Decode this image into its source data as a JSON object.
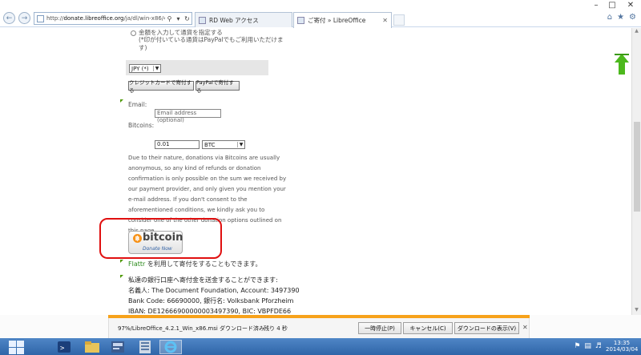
{
  "browser": {
    "url_prefix": "http://",
    "url_host": "donate.libreoffice.org",
    "url_path": "/ja/dl/win-x86/4.2.1/ja/Li",
    "tabs": [
      {
        "label": "RD Web アクセス"
      },
      {
        "label": "ご寄付 » LibreOffice"
      }
    ]
  },
  "page": {
    "amount_label": "金額を入力して通貨を指定する",
    "amount_note": "(*印が付いている通貨はPayPalでもご利用いただけます)",
    "currency_value": "JPY (*)",
    "card_button": "クレジットカードで寄付する",
    "paypal_button": "PayPalで寄付する",
    "email_label": "Email:",
    "email_placeholder": "Email address (optional)",
    "bitcoins_label": "Bitcoins:",
    "btc_amount": "0.01",
    "btc_currency": "BTC",
    "disclaimer": "Due to their nature, donations via Bitcoins are usually anonymous, so any kind of refunds or donation confirmation is only possible on the sum we received by our payment provider, and only given you mention your e-mail address. If you don't consent to the aforementioned conditions, we kindly ask you to consider one of the other donation options outlined on this page.",
    "bitcoin_button_word": "bitcoin",
    "bitcoin_button_sub": "Donate Now",
    "flattr_link": "Flattr",
    "flattr_text": " を利用して寄付をすることもできます。",
    "bank_lines": [
      "私達の銀行口座へ寄付金を送金することができます:",
      "名義人: The Document Foundation, Account: 3497390",
      "Bank Code: 66690000, 銀行名: Volksbank Pforzheim",
      "IBAN: DE12666900000003497390, BIC: VBPFDE66"
    ]
  },
  "download": {
    "filename": "97%/LibreOffice_4.2.1_Win_x86.msi ダウンロード済み",
    "remaining": "残り 4 秒",
    "pause_label": "一時停止(P)",
    "cancel_label": "キャンセル(C)",
    "view_label": "ダウンロードの表示(V)",
    "progress": 0.97
  },
  "taskbar": {
    "time": "13:35",
    "date": "2014/03/04"
  },
  "colors": {
    "accent_orange": "#f7a21b",
    "highlight_red": "#e01010",
    "taskbar_blue": "#2f65a8",
    "bitcoin_orange": "#f7931a",
    "flattr_green": "#2a8a1a"
  }
}
